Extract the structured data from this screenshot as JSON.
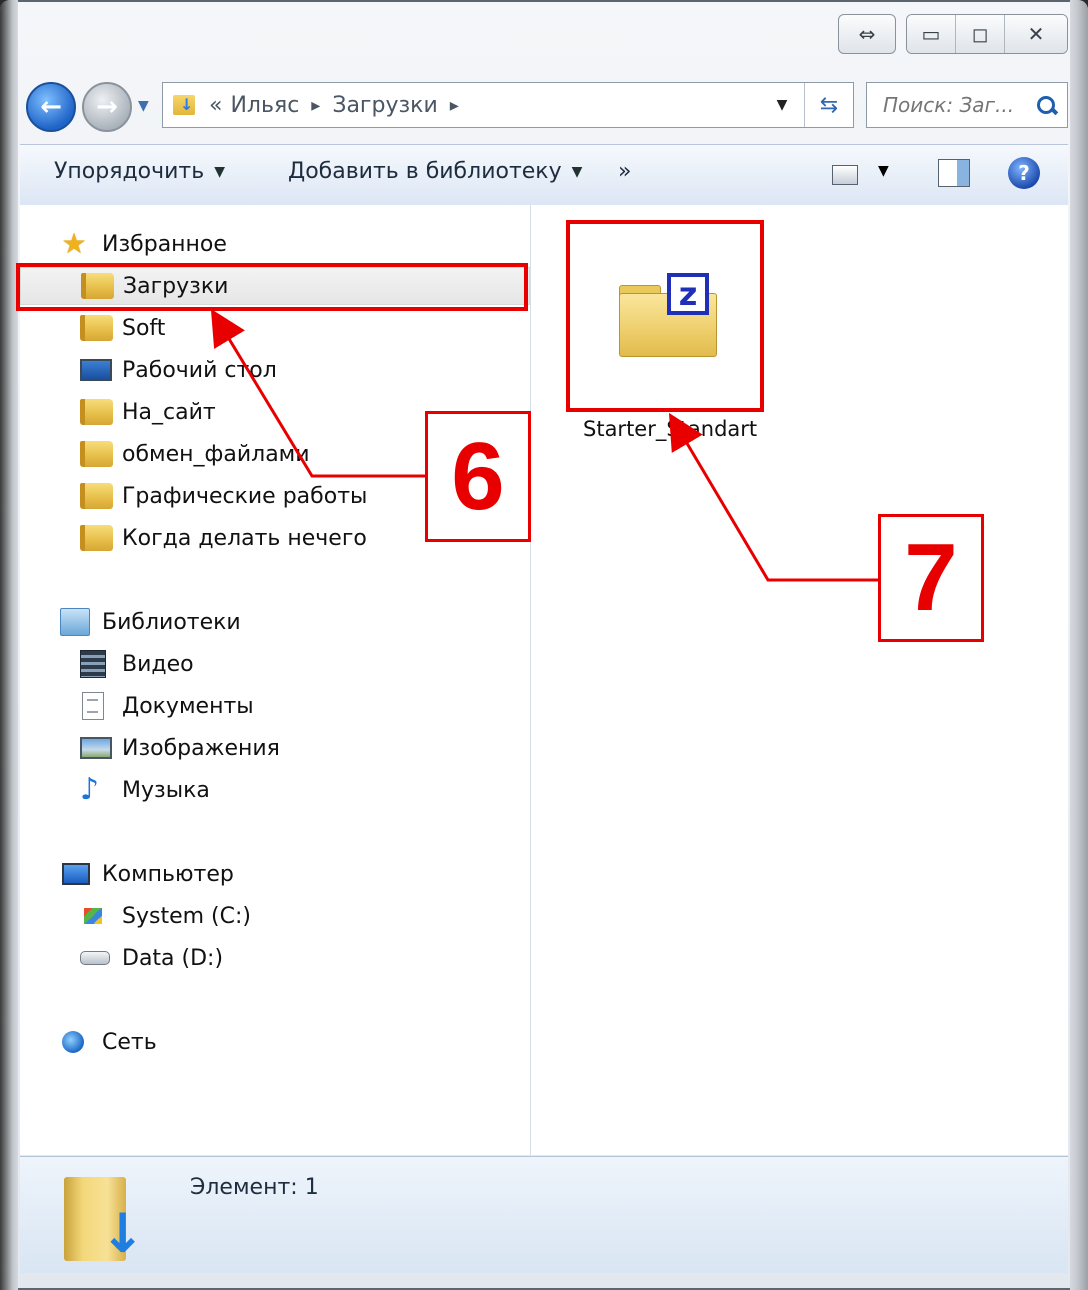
{
  "address_bar": {
    "overflow": "«",
    "segments": [
      "Ильяс",
      "Загрузки"
    ]
  },
  "search": {
    "placeholder": "Поиск: Заг..."
  },
  "toolbar": {
    "organize": "Упорядочить",
    "add_to_library": "Добавить в библиотеку",
    "more": "»"
  },
  "nav": {
    "favorites": {
      "label": "Избранное",
      "items": [
        "Загрузки",
        "Soft",
        "Рабочий стол",
        "На_сайт",
        "обмен_файлами",
        "Графические работы",
        "Когда делать нечего"
      ]
    },
    "libraries": {
      "label": "Библиотеки",
      "items": [
        "Видео",
        "Документы",
        "Изображения",
        "Музыка"
      ]
    },
    "computer": {
      "label": "Компьютер",
      "items": [
        "System (C:)",
        "Data (D:)"
      ]
    },
    "network": {
      "label": "Сеть"
    }
  },
  "files": [
    {
      "name": "Starter_Standart",
      "badge": "z"
    }
  ],
  "status": {
    "text": "Элемент: 1"
  },
  "annotations": {
    "step_a": "6",
    "step_b": "7"
  },
  "colors": {
    "annotation": "#e80000",
    "toolbar_bg": "#dce6f4",
    "selection": "#e6e6e6"
  },
  "icons": {
    "back": "back-arrow-icon",
    "forward": "forward-arrow-icon",
    "refresh": "refresh-icon",
    "search": "search-icon",
    "view": "view-options-icon",
    "preview": "preview-pane-icon",
    "help": "help-icon"
  }
}
